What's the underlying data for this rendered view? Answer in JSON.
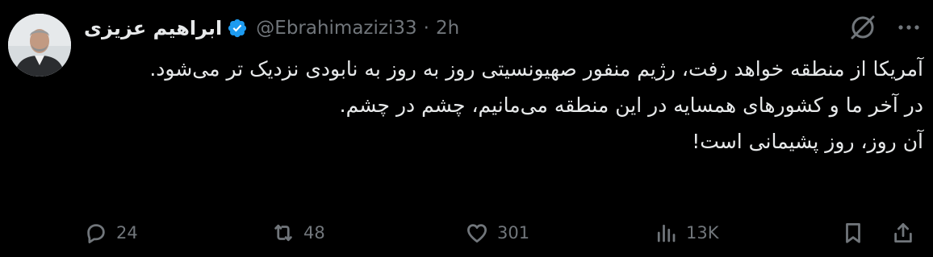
{
  "author": {
    "display_name": "ابراهیم عزیزی",
    "handle": "@Ebrahimazizi33",
    "separator": "·",
    "time": "2h",
    "verified": true,
    "badge_color": "#1d9bf0"
  },
  "tweet": {
    "lines": [
      "آمریکا از منطقه خواهد رفت، رژیم منفور صهیونسیتی روز به روز به نابودی نزدیک تر می‌شود.",
      "در آخر ما و کشورهای همسایه در این منطقه می‌مانیم، چشم در چشم.",
      "آن روز، روز پشیمانی است!"
    ]
  },
  "actions": {
    "reply": {
      "icon": "reply-icon",
      "count": "24"
    },
    "repost": {
      "icon": "repost-icon",
      "count": "48"
    },
    "like": {
      "icon": "heart-icon",
      "count": "301"
    },
    "views": {
      "icon": "views-icon",
      "count": "13K"
    },
    "bookmark": {
      "icon": "bookmark-icon"
    },
    "share": {
      "icon": "share-icon"
    }
  },
  "colors": {
    "background": "#000000",
    "primary_text": "#e7e9ea",
    "secondary_text": "#71767b"
  }
}
